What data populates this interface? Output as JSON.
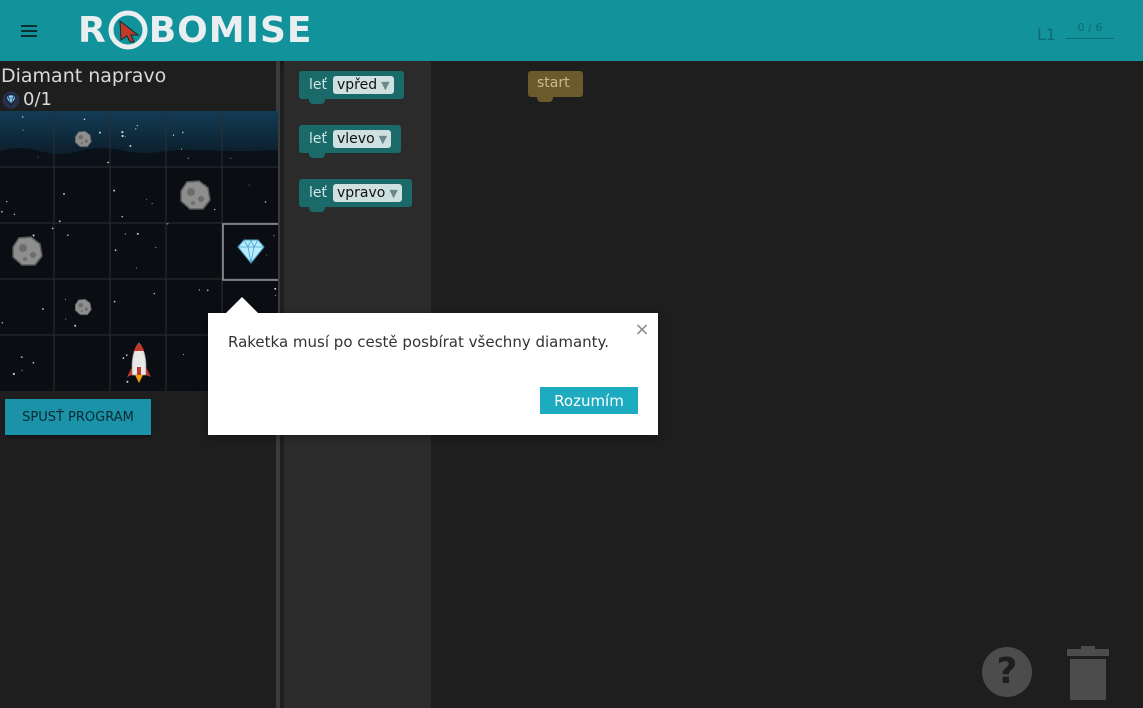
{
  "header": {
    "logo_part1": "R",
    "logo_part2": "BOMISE",
    "level": "L1",
    "progress": "0 / 6",
    "colors": {
      "bar": "#12929b",
      "text": "#0d6b73"
    }
  },
  "task": {
    "title": "Diamant napravo",
    "diamonds": "0/1",
    "run_button": "SPUSŤ PROGRAM",
    "grid": {
      "rows": 5,
      "cols": 5,
      "cells": [
        {
          "r": 0,
          "c": 1,
          "type": "asteroid-small"
        },
        {
          "r": 1,
          "c": 3,
          "type": "asteroid-large"
        },
        {
          "r": 2,
          "c": 0,
          "type": "asteroid-large"
        },
        {
          "r": 2,
          "c": 4,
          "type": "diamond"
        },
        {
          "r": 3,
          "c": 1,
          "type": "asteroid-small"
        },
        {
          "r": 4,
          "c": 2,
          "type": "rocket"
        }
      ]
    }
  },
  "toolbox": {
    "blocks": [
      {
        "label": "leť",
        "option": "vpřed"
      },
      {
        "label": "leť",
        "option": "vlevo"
      },
      {
        "label": "leť",
        "option": "vpravo"
      }
    ]
  },
  "workspace": {
    "start_label": "start"
  },
  "popup": {
    "text": "Raketka musí po cestě posbírat všechny diamanty.",
    "button": "Rozumím",
    "close": "×"
  }
}
